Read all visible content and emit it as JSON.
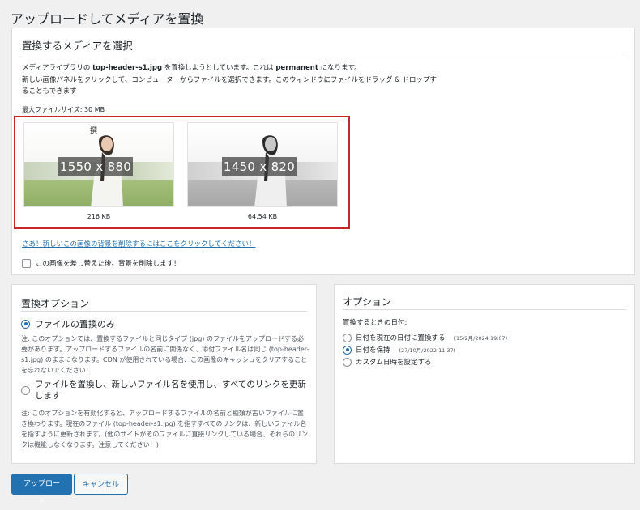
{
  "page": {
    "title": "アップロードしてメディアを置換"
  },
  "select_panel": {
    "title": "置換するメディアを選択",
    "desc_line1_pre": "メディアライブラリの ",
    "desc_filename": "top-header-s1.jpg",
    "desc_line1_mid": " を置換しようとしています。これは ",
    "desc_mode": "permanent",
    "desc_line1_post": " になります。",
    "desc_line2": "新しい画像パネルをクリックして、コンピューターからファイルを選択できます。このウィンドウにファイルをドラッグ & ドロップすることもできます",
    "max_size": "最大ファイルサイズ: 30 MB",
    "current_image": {
      "dimensions": "1550 x 880",
      "size": "216 KB",
      "overlay_text": "撰"
    },
    "new_image": {
      "dimensions": "1450 x 820",
      "size": "64.54 KB"
    },
    "remove_bg_link": "さあ！新しいこの画像の背景を削除するにはここをクリックしてください！",
    "remove_bg_checkbox": "この画像を差し替えた後、背景を削除します！"
  },
  "replace_panel": {
    "title": "置換オプション",
    "opt1_label": "ファイルの置換のみ",
    "opt1_note": "注: このオプションでは、置換するファイルと同じタイプ (jpg) のファイルをアップロードする必要があります。アップロードするファイルの名前に関係なく、添付ファイル名は同じ (top-header-s1.jpg) のままになります。CDN が使用されている場合、この画像のキャッシュをクリアすることを忘れないでください！",
    "opt2_label": "ファイルを置換し、新しいファイル名を使用し、すべてのリンクを更新します",
    "opt2_note": "注: このオプションを有効化すると、アップロードするファイルの名前と種類が古いファイルに置き換わります。現在のファイル (top-header-s1.jpg) を指すすべてのリンクは、新しいファイル名を指すように更新されます。(他のサイトがそのファイルに直接リンクしている場合、それらのリンクは機能しなくなります。注意してください！)"
  },
  "options_panel": {
    "title": "オプション",
    "date_label": "置換するときの日付:",
    "date_opt1": "日付を現在の日付に置換する",
    "date_opt1_meta": "(15/2月/2024 19:07)",
    "date_opt2": "日付を保持",
    "date_opt2_meta": "(27/10月/2022 11:37)",
    "date_opt3": "カスタム日時を設定する"
  },
  "buttons": {
    "upload": "アップロード",
    "cancel": "キャンセル"
  },
  "colors": {
    "accent": "#2271b1",
    "highlight_border": "#c62828"
  }
}
